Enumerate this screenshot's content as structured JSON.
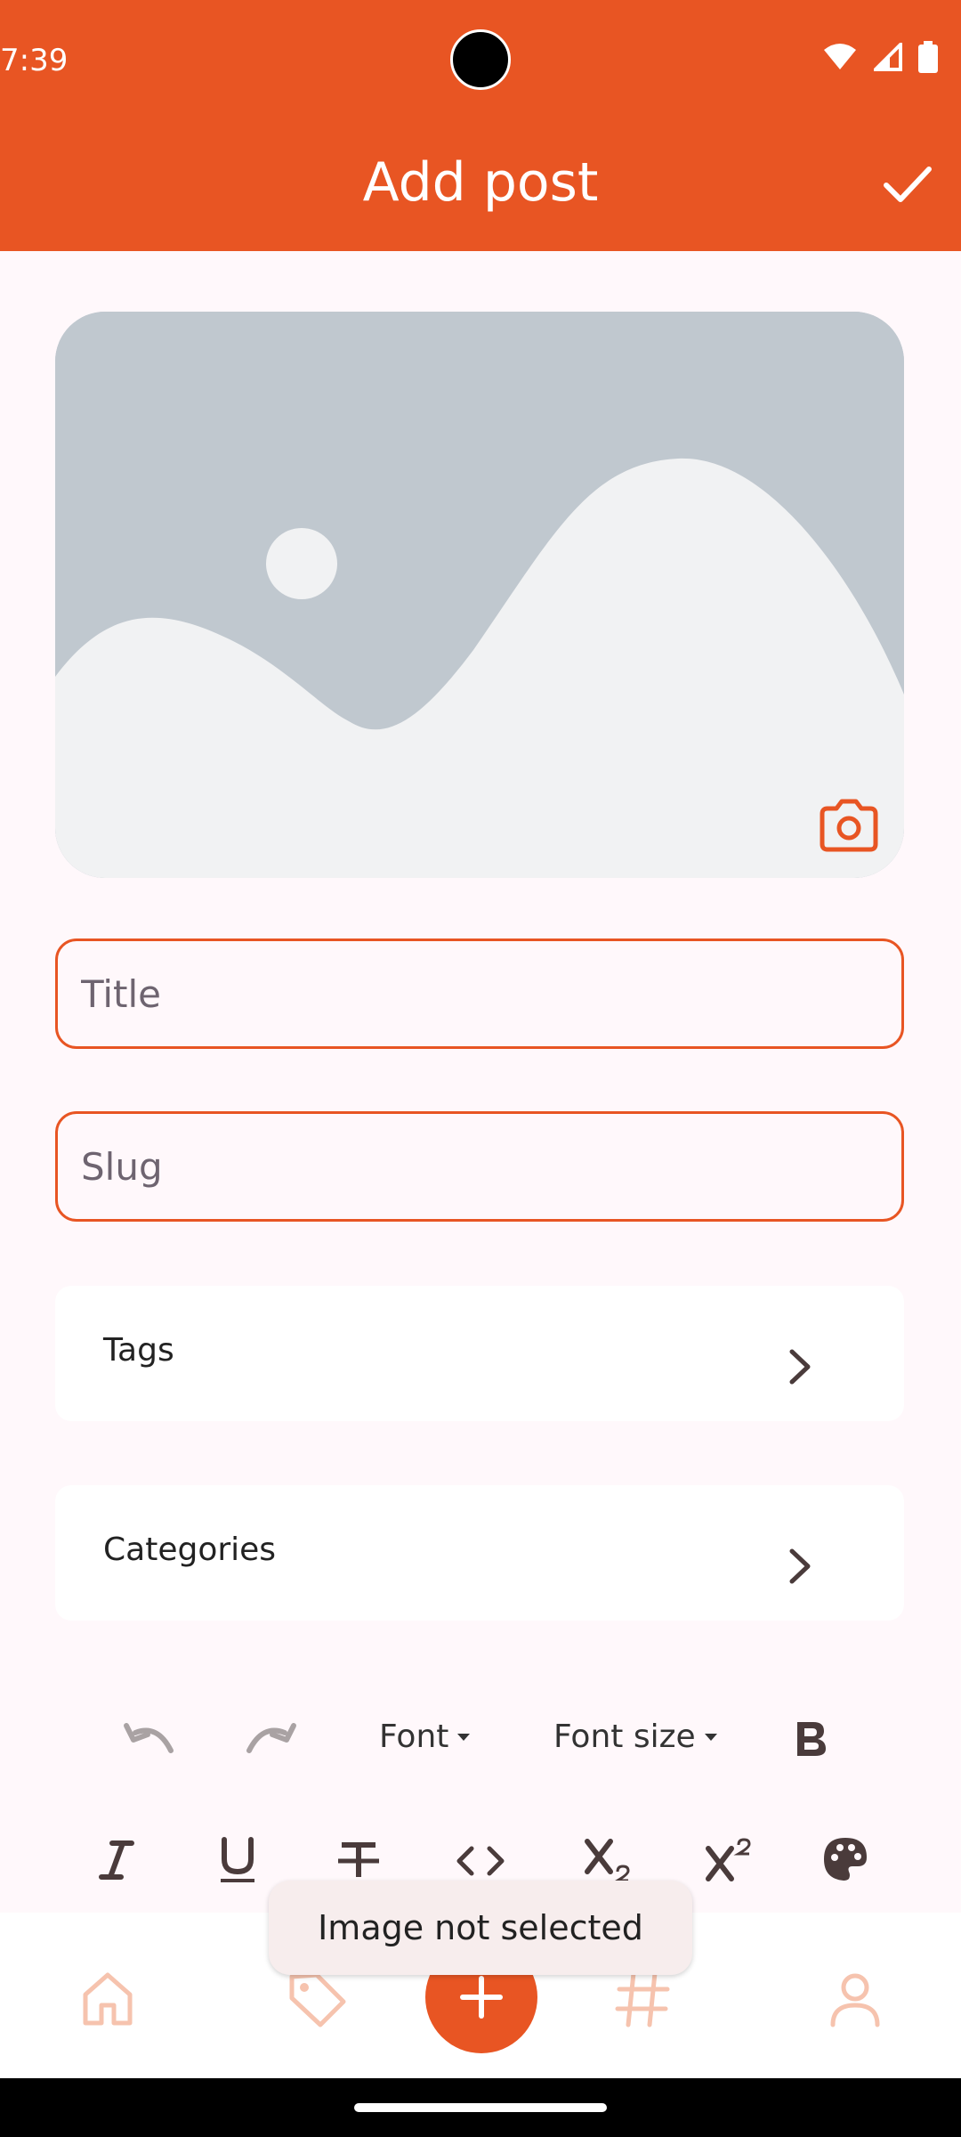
{
  "status": {
    "time": "7:39"
  },
  "app_bar": {
    "title": "Add post"
  },
  "form": {
    "title_placeholder": "Title",
    "slug_placeholder": "Slug",
    "tags_label": "Tags",
    "categories_label": "Categories"
  },
  "toolbar": {
    "font_label": "Font",
    "font_size_label": "Font size"
  },
  "snackbar": {
    "message": "Image not selected"
  },
  "colors": {
    "accent": "#E85523",
    "background": "#FFF8FB",
    "placeholder_image_bg": "#C0C8CF",
    "placeholder_image_fg": "#F1F2F3"
  },
  "icons": {
    "confirm": "check-icon",
    "image_picker": "camera-icon",
    "tags_arrow": "chevron-right-icon",
    "categories_arrow": "chevron-right-icon",
    "undo": "undo-icon",
    "redo": "redo-icon",
    "bold": "bold-icon",
    "italic": "italic-icon",
    "underline": "underline-icon",
    "strikethrough": "strikethrough-icon",
    "code": "code-icon",
    "subscript": "subscript-icon",
    "superscript": "superscript-icon",
    "color": "palette-icon",
    "nav_home": "home-icon",
    "nav_tags": "tag-icon",
    "nav_add": "plus-icon",
    "nav_hash": "hashtag-icon",
    "nav_profile": "person-icon"
  }
}
